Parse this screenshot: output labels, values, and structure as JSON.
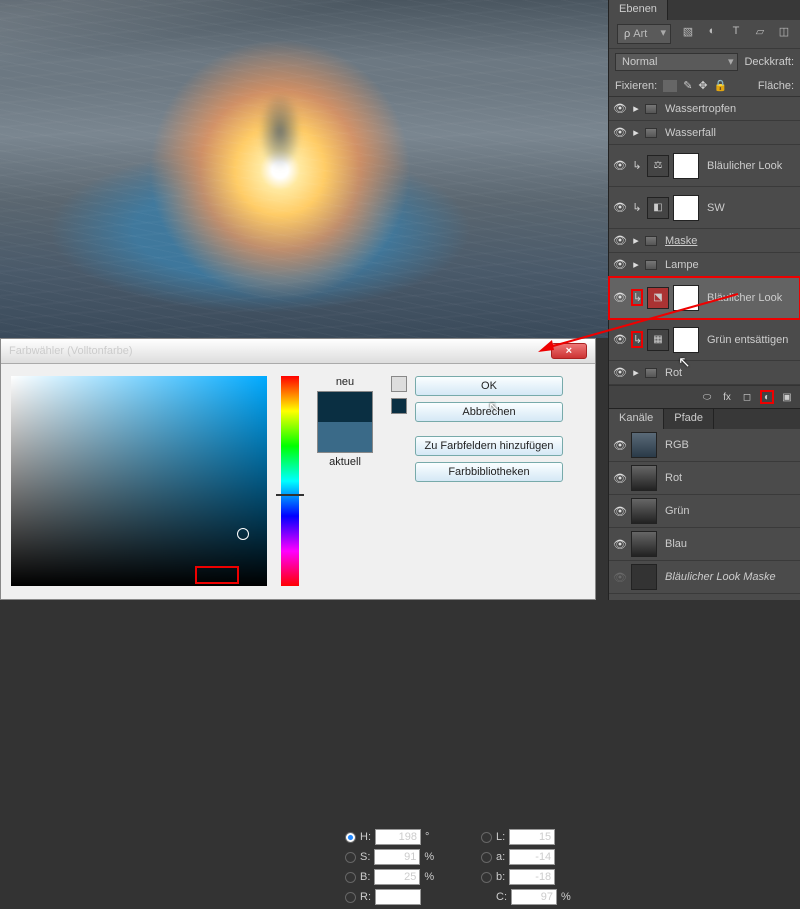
{
  "panel": {
    "tab_layers": "Ebenen",
    "search_label": "Art",
    "blend_mode": "Normal",
    "opacity_label": "Deckkraft:",
    "lock_label": "Fixieren:",
    "fill_label": "Fläche:",
    "layers": [
      {
        "name": "Wassertropfen",
        "type": "group"
      },
      {
        "name": "Wasserfall",
        "type": "group"
      },
      {
        "name": "Bläulicher Look",
        "type": "adj",
        "icon": "⚖"
      },
      {
        "name": "SW",
        "type": "adj",
        "icon": "◧"
      },
      {
        "name": "Maske",
        "type": "group",
        "u": true
      },
      {
        "name": "Lampe",
        "type": "group"
      },
      {
        "name": "Bläulicher Look",
        "type": "adj-sel",
        "icon": "⬔"
      },
      {
        "name": "Grün entsättigen",
        "type": "adj-red",
        "icon": "▦"
      },
      {
        "name": "Rot",
        "type": "group"
      }
    ],
    "tab_channels": "Kanäle",
    "tab_paths": "Pfade",
    "channels": [
      {
        "name": "RGB"
      },
      {
        "name": "Rot"
      },
      {
        "name": "Grün"
      },
      {
        "name": "Blau"
      },
      {
        "name": "Bläulicher Look Maske"
      }
    ]
  },
  "dialog": {
    "title": "Farbwähler (Volltonfarbe)",
    "new_label": "neu",
    "current_label": "aktuell",
    "ok": "OK",
    "cancel": "Abbrechen",
    "add_swatch": "Zu Farbfeldern hinzufügen",
    "libs": "Farbbibliotheken",
    "fields": {
      "H": {
        "label": "H:",
        "val": "198",
        "unit": "°"
      },
      "S": {
        "label": "S:",
        "val": "91",
        "unit": "%"
      },
      "B": {
        "label": "B:",
        "val": "25",
        "unit": "%"
      },
      "R": {
        "label": "R:",
        "val": "",
        "unit": ""
      },
      "L": {
        "label": "L:",
        "val": "15",
        "unit": ""
      },
      "a": {
        "label": "a:",
        "val": "-14",
        "unit": ""
      },
      "b": {
        "label": "b:",
        "val": "-18",
        "unit": ""
      },
      "C": {
        "label": "C:",
        "val": "97",
        "unit": "%"
      }
    }
  }
}
